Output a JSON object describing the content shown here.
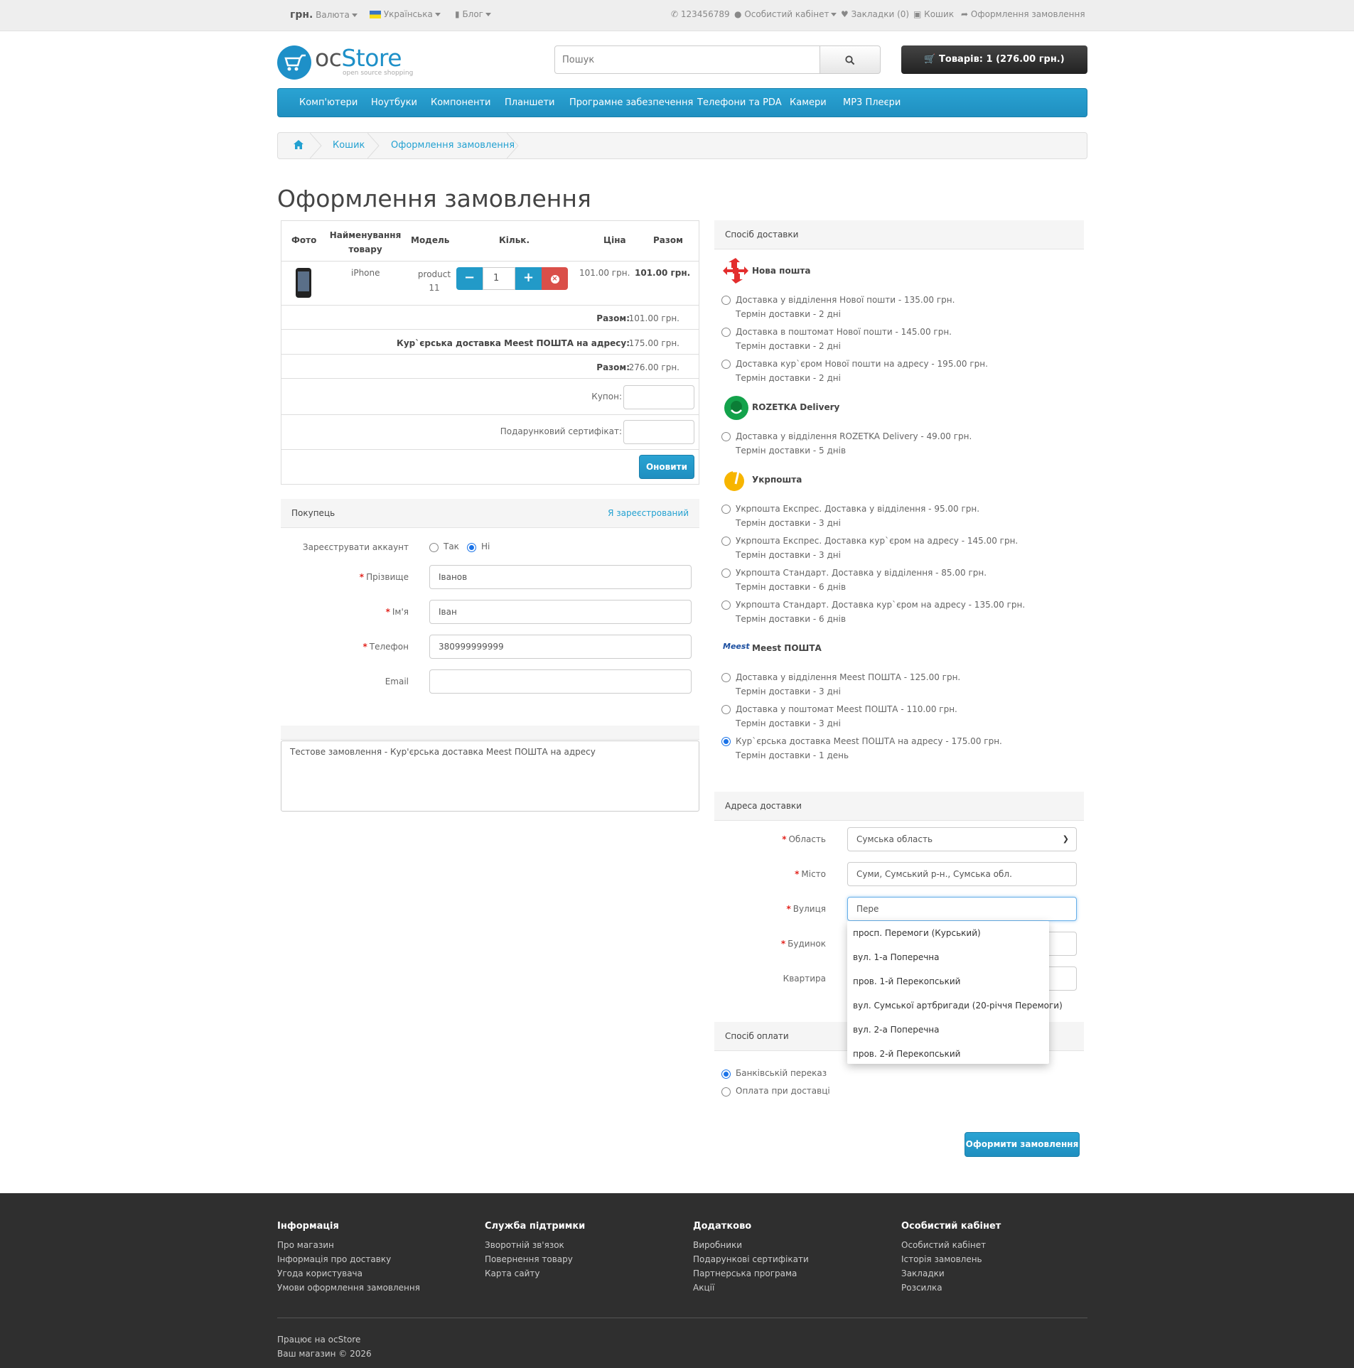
{
  "topbar": {
    "currency_symbol": "грн.",
    "currency_label": "Валюта",
    "language": "Українська",
    "blog": "Блог",
    "phone": "123456789",
    "account": "Особистий кабінет",
    "wishlist": "Закладки (0)",
    "cart": "Кошик",
    "checkout": "Оформлення замовлення"
  },
  "header": {
    "logo_oc": "oc",
    "logo_store": "Store",
    "logo_sub": "open source shopping",
    "search_placeholder": "Пошук",
    "cart_button": "Товарів: 1 (276.00 грн.)"
  },
  "menu": [
    "Комп'ютери",
    "Ноутбуки",
    "Компоненти",
    "Планшети",
    "Програмне забезпечення",
    "Телефони та PDA",
    "Камери",
    "MP3 Плеєри"
  ],
  "breadcrumb": [
    "Кошик",
    "Оформлення замовлення"
  ],
  "page_title": "Оформлення замовлення",
  "cart": {
    "headers": [
      "Фото",
      "Найменування товару",
      "Модель",
      "Кільк.",
      "Ціна",
      "Разом"
    ],
    "product": {
      "name": "iPhone",
      "model": "product 11",
      "qty": "1",
      "price": "101.00 грн.",
      "total": "101.00 грн."
    },
    "subtotal_label": "Разом:",
    "subtotal_value": "101.00 грн.",
    "shipping_label": "Кур`єрська доставка Meest ПОШТА на адресу:",
    "shipping_value": "175.00 грн.",
    "total_label": "Разом:",
    "total_value": "276.00 грн.",
    "coupon_label": "Купон:",
    "voucher_label": "Подарунковий сертифікат:",
    "update_button": "Оновити"
  },
  "customer": {
    "title": "Покупець",
    "login_link": "Я зареєстрований",
    "register_label": "Зареєструвати аккаунт",
    "yes": "Так",
    "no": "Ні",
    "lastname_label": "Прізвище",
    "lastname_value": "Іванов",
    "firstname_label": "Ім'я",
    "firstname_value": "Іван",
    "phone_label": "Телефон",
    "phone_value": "380999999999",
    "email_label": "Email",
    "email_value": ""
  },
  "comment": "Тестове замовлення - Кур'єрська доставка Meest ПОШТА на адресу",
  "shipping": {
    "title": "Спосіб доставки",
    "carriers": [
      {
        "name": "Нова пошта",
        "options": [
          {
            "text": "Доставка у відділення Нової пошти - 135.00 грн.",
            "term": "Термін доставки - 2 дні"
          },
          {
            "text": "Доставка в поштомат Нової пошти - 145.00 грн.",
            "term": "Термін доставки - 2 дні"
          },
          {
            "text": "Доставка кур`єром Нової пошти на адресу - 195.00 грн.",
            "term": "Термін доставки - 2 дні"
          }
        ]
      },
      {
        "name": "ROZETKA Delivery",
        "options": [
          {
            "text": "Доставка у відділення ROZETKA Delivery - 49.00 грн.",
            "term": "Термін доставки - 5 днів"
          }
        ]
      },
      {
        "name": "Укрпошта",
        "options": [
          {
            "text": "Укрпошта Експрес. Доставка у відділення - 95.00 грн.",
            "term": "Термін доставки - 3 дні"
          },
          {
            "text": "Укрпошта Експрес. Доставка кур`єром на адресу - 145.00 грн.",
            "term": "Термін доставки - 3 дні"
          },
          {
            "text": "Укрпошта Стандарт. Доставка у відділення - 85.00 грн.",
            "term": "Термін доставки - 6 днів"
          },
          {
            "text": "Укрпошта Стандарт. Доставка кур`єром на адресу - 135.00 грн.",
            "term": "Термін доставки - 6 днів"
          }
        ]
      },
      {
        "name": "Meest ПОШТА",
        "logo_text": "Meest",
        "options": [
          {
            "text": "Доставка у відділення Meest ПОШТА - 125.00 грн.",
            "term": "Термін доставки - 3 дні"
          },
          {
            "text": "Доставка у поштомат Meest ПОШТА - 110.00 грн.",
            "term": "Термін доставки - 3 дні"
          },
          {
            "text": "Кур`єрська доставка Meest ПОШТА на адресу - 175.00 грн.",
            "term": "Термін доставки - 1 день"
          }
        ]
      }
    ]
  },
  "address": {
    "title": "Адреса доставки",
    "region_label": "Область",
    "region_value": "Сумська область",
    "city_label": "Місто",
    "city_value": "Суми, Сумський р-н., Сумська обл.",
    "street_label": "Вулиця",
    "street_value": "Пере",
    "house_label": "Будинок",
    "flat_label": "Квартира",
    "suggestions": [
      "просп. Перемоги (Курський)",
      "вул. 1-а Поперечна",
      "пров. 1-й Перекопський",
      "вул. Сумської артбригади (20-річчя Перемоги)",
      "вул. 2-а Поперечна",
      "пров. 2-й Перекопський"
    ]
  },
  "payment": {
    "title": "Спосіб оплати",
    "options": [
      "Банківській переказ",
      "Оплата при доставці"
    ]
  },
  "submit_button": "Оформити замовлення",
  "footer": {
    "columns": [
      {
        "title": "Інформація",
        "links": [
          "Про магазин",
          "Інформація про доставку",
          "Угода користувача",
          "Умови оформлення замовлення"
        ]
      },
      {
        "title": "Служба підтримки",
        "links": [
          "Зворотній зв'язок",
          "Повернення товару",
          "Карта сайту"
        ]
      },
      {
        "title": "Додатково",
        "links": [
          "Виробники",
          "Подарункові сертифікати",
          "Партнерська програма",
          "Акції"
        ]
      },
      {
        "title": "Особистий кабінет",
        "links": [
          "Особистий кабінет",
          "Історія замовлень",
          "Закладки",
          "Розсилка"
        ]
      }
    ],
    "powered": "Працює на ocStore",
    "copyright": "Ваш магазин © 2026"
  },
  "colors": {
    "accent": "#229ac8",
    "danger": "#da4f49",
    "dark": "#2f2f2f"
  }
}
